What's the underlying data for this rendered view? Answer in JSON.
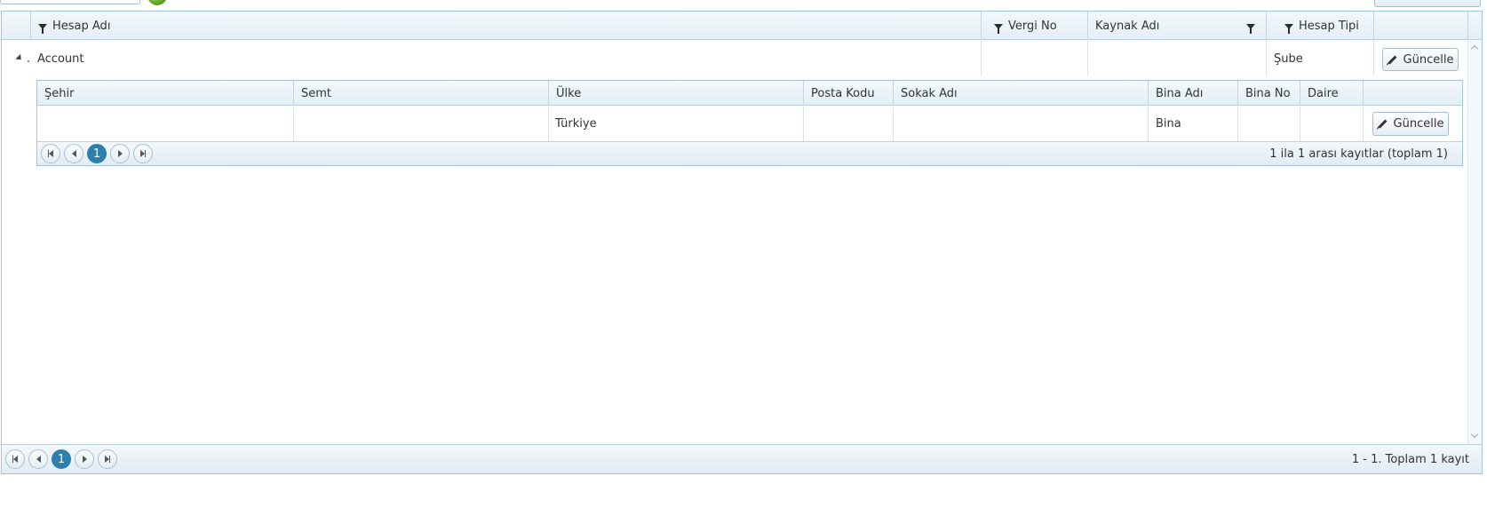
{
  "grid": {
    "columns": {
      "account_name": "Hesap Adı",
      "tax_no": "Vergi No",
      "source_name": "Kaynak Adı",
      "account_type": "Hesap Tipi"
    },
    "row": {
      "account_name": "Account",
      "dot": ".",
      "account_type": "Şube",
      "update_label": "Güncelle"
    },
    "pager": {
      "current_page": "1",
      "summary": "1 - 1. Toplam 1 kayıt"
    }
  },
  "detail": {
    "columns": {
      "city": "Şehir",
      "district": "Semt",
      "country": "Ülke",
      "postal_code": "Posta Kodu",
      "street": "Sokak Adı",
      "building_name": "Bina Adı",
      "building_no": "Bina No",
      "apartment": "Daire"
    },
    "row": {
      "country": "Türkiye",
      "building_name": "Bina",
      "update_label": "Güncelle"
    },
    "pager": {
      "current_page": "1",
      "summary": "1 ila 1 arası kayıtlar (toplam 1)"
    }
  }
}
